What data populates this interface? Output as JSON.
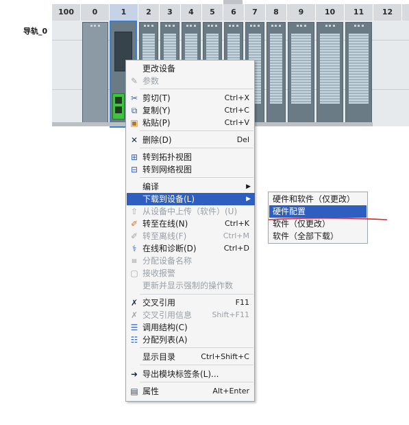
{
  "rack": {
    "rail_label": "导轨_0",
    "slots": [
      "100",
      "0",
      "1",
      "2",
      "3",
      "4",
      "5",
      "6",
      "7",
      "8",
      "9",
      "10",
      "11",
      "12"
    ]
  },
  "menu": {
    "items": [
      {
        "name": "change-device",
        "icon": "change-device-icon",
        "label": "更改设备",
        "shortcut": "",
        "disabled": false
      },
      {
        "name": "parameters",
        "icon": "parameters-icon",
        "label": "参数",
        "shortcut": "",
        "disabled": true
      },
      {
        "name": "cut",
        "icon": "scissors-icon",
        "label": "剪切(T)",
        "shortcut": "Ctrl+X",
        "disabled": false
      },
      {
        "name": "copy",
        "icon": "copy-icon",
        "label": "复制(Y)",
        "shortcut": "Ctrl+C",
        "disabled": false
      },
      {
        "name": "paste",
        "icon": "paste-icon",
        "label": "粘贴(P)",
        "shortcut": "Ctrl+V",
        "disabled": false
      },
      {
        "name": "delete",
        "icon": "delete-icon",
        "label": "删除(D)",
        "shortcut": "Del",
        "disabled": false
      },
      {
        "name": "goto-topology",
        "icon": "topology-icon",
        "label": "转到拓扑视图",
        "shortcut": "",
        "disabled": false
      },
      {
        "name": "goto-network",
        "icon": "network-icon",
        "label": "转到网络视图",
        "shortcut": "",
        "disabled": false
      },
      {
        "name": "compile",
        "icon": "",
        "label": "编译",
        "shortcut": "",
        "disabled": false
      },
      {
        "name": "download-to-device",
        "icon": "",
        "label": "下载到设备(L)",
        "shortcut": "",
        "disabled": false
      },
      {
        "name": "upload-from-device",
        "icon": "upload-icon",
        "label": "从设备中上传（软件）(U)",
        "shortcut": "",
        "disabled": true
      },
      {
        "name": "go-online",
        "icon": "go-online-icon",
        "label": "转至在线(N)",
        "shortcut": "Ctrl+K",
        "disabled": false
      },
      {
        "name": "go-offline",
        "icon": "go-offline-icon",
        "label": "转至离线(F)",
        "shortcut": "Ctrl+M",
        "disabled": true
      },
      {
        "name": "online-diagnostics",
        "icon": "diagnostics-icon",
        "label": "在线和诊断(D)",
        "shortcut": "Ctrl+D",
        "disabled": false
      },
      {
        "name": "assign-device-name",
        "icon": "name-tag-icon",
        "label": "分配设备名称",
        "shortcut": "",
        "disabled": true
      },
      {
        "name": "receive-alarms",
        "icon": "alarm-icon",
        "label": "接收报警",
        "shortcut": "",
        "disabled": true
      },
      {
        "name": "update-forced-ops",
        "icon": "",
        "label": "更新并显示强制的操作数",
        "shortcut": "",
        "disabled": true
      },
      {
        "name": "cross-reference",
        "icon": "cross-ref-icon",
        "label": "交叉引用",
        "shortcut": "F11",
        "disabled": false
      },
      {
        "name": "cross-reference-info",
        "icon": "cross-ref-info-icon",
        "label": "交叉引用信息",
        "shortcut": "Shift+F11",
        "disabled": true
      },
      {
        "name": "call-structure",
        "icon": "call-structure-icon",
        "label": "调用结构(C)",
        "shortcut": "",
        "disabled": false
      },
      {
        "name": "assignment-list",
        "icon": "assignment-list-icon",
        "label": "分配列表(A)",
        "shortcut": "",
        "disabled": false
      },
      {
        "name": "show-catalog",
        "icon": "",
        "label": "显示目录",
        "shortcut": "Ctrl+Shift+C",
        "disabled": false
      },
      {
        "name": "export-labels",
        "icon": "export-icon",
        "label": "导出模块标签条(L)...",
        "shortcut": "",
        "disabled": false
      },
      {
        "name": "properties",
        "icon": "properties-icon",
        "label": "属性",
        "shortcut": "Alt+Enter",
        "disabled": false
      }
    ]
  },
  "submenu": {
    "items": [
      {
        "name": "hw-and-sw-changes",
        "label": "硬件和软件（仅更改）"
      },
      {
        "name": "hardware-config",
        "label": "硬件配置"
      },
      {
        "name": "software-changes",
        "label": "软件（仅更改）"
      },
      {
        "name": "software-all",
        "label": "软件（全部下载）"
      }
    ]
  },
  "colors": {
    "highlight": "#2e5fc0",
    "annotation": "#e0202a"
  }
}
